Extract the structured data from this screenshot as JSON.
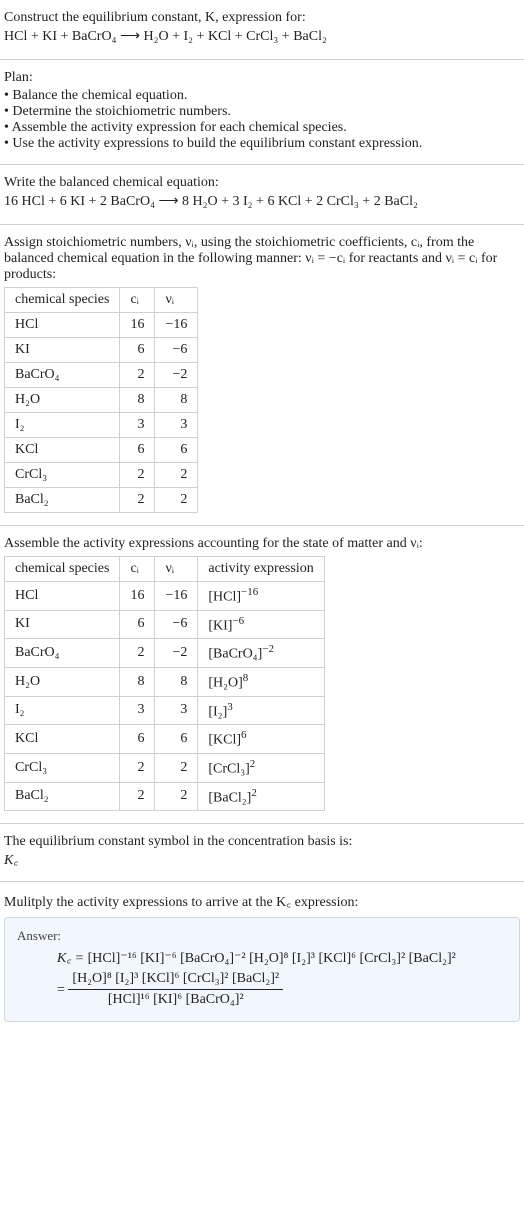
{
  "header": {
    "line1": "Construct the equilibrium constant, K, expression for:",
    "equation": "HCl + KI + BaCrO₄ ⟶ H₂O + I₂ + KCl + CrCl₃ + BaCl₂"
  },
  "plan": {
    "title": "Plan:",
    "b1": "• Balance the chemical equation.",
    "b2": "• Determine the stoichiometric numbers.",
    "b3": "• Assemble the activity expression for each chemical species.",
    "b4": "• Use the activity expressions to build the equilibrium constant expression."
  },
  "balanced": {
    "title": "Write the balanced chemical equation:",
    "equation": "16 HCl + 6 KI + 2 BaCrO₄ ⟶ 8 H₂O + 3 I₂ + 6 KCl + 2 CrCl₃ + 2 BaCl₂"
  },
  "stoich": {
    "intro": "Assign stoichiometric numbers, νᵢ, using the stoichiometric coefficients, cᵢ, from the balanced chemical equation in the following manner: νᵢ = −cᵢ for reactants and νᵢ = cᵢ for products:",
    "h0": "chemical species",
    "h1": "cᵢ",
    "h2": "νᵢ",
    "rows": [
      {
        "sp": "HCl",
        "c": "16",
        "v": "−16"
      },
      {
        "sp": "KI",
        "c": "6",
        "v": "−6"
      },
      {
        "sp": "BaCrO₄",
        "c": "2",
        "v": "−2"
      },
      {
        "sp": "H₂O",
        "c": "8",
        "v": "8"
      },
      {
        "sp": "I₂",
        "c": "3",
        "v": "3"
      },
      {
        "sp": "KCl",
        "c": "6",
        "v": "6"
      },
      {
        "sp": "CrCl₃",
        "c": "2",
        "v": "2"
      },
      {
        "sp": "BaCl₂",
        "c": "2",
        "v": "2"
      }
    ]
  },
  "activity": {
    "intro": "Assemble the activity expressions accounting for the state of matter and νᵢ:",
    "h0": "chemical species",
    "h1": "cᵢ",
    "h2": "νᵢ",
    "h3": "activity expression",
    "rows": [
      {
        "sp": "HCl",
        "c": "16",
        "v": "−16",
        "ae_base": "[HCl]",
        "ae_pow": "−16"
      },
      {
        "sp": "KI",
        "c": "6",
        "v": "−6",
        "ae_base": "[KI]",
        "ae_pow": "−6"
      },
      {
        "sp": "BaCrO₄",
        "c": "2",
        "v": "−2",
        "ae_base": "[BaCrO₄]",
        "ae_pow": "−2"
      },
      {
        "sp": "H₂O",
        "c": "8",
        "v": "8",
        "ae_base": "[H₂O]",
        "ae_pow": "8"
      },
      {
        "sp": "I₂",
        "c": "3",
        "v": "3",
        "ae_base": "[I₂]",
        "ae_pow": "3"
      },
      {
        "sp": "KCl",
        "c": "6",
        "v": "6",
        "ae_base": "[KCl]",
        "ae_pow": "6"
      },
      {
        "sp": "CrCl₃",
        "c": "2",
        "v": "2",
        "ae_base": "[CrCl₃]",
        "ae_pow": "2"
      },
      {
        "sp": "BaCl₂",
        "c": "2",
        "v": "2",
        "ae_base": "[BaCl₂]",
        "ae_pow": "2"
      }
    ]
  },
  "ksymbol": {
    "intro": "The equilibrium constant symbol in the concentration basis is:",
    "sym": "K꜀"
  },
  "multiply": {
    "intro": "Mulitply the activity expressions to arrive at the K꜀ expression:"
  },
  "answer": {
    "label": "Answer:",
    "lhs": "K꜀ = ",
    "flat": "[HCl]⁻¹⁶ [KI]⁻⁶ [BaCrO₄]⁻² [H₂O]⁸ [I₂]³ [KCl]⁶ [CrCl₃]² [BaCl₂]²",
    "eq2_lhs": " = ",
    "frac_num": "[H₂O]⁸ [I₂]³ [KCl]⁶ [CrCl₃]² [BaCl₂]²",
    "frac_den": "[HCl]¹⁶ [KI]⁶ [BaCrO₄]²"
  }
}
